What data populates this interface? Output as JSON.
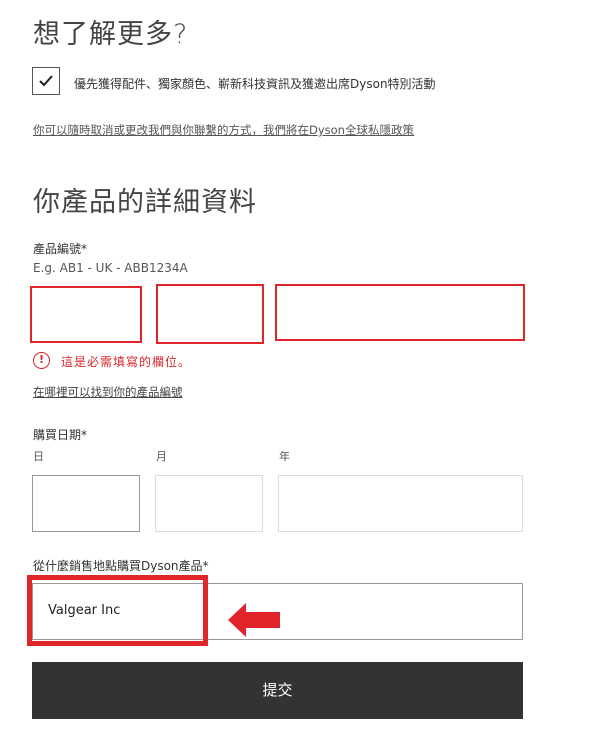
{
  "marketing": {
    "title": "想了解更多?",
    "consent_text": "優先獲得配件、獨家顏色、嶄新科技資訊及獲邀出席Dyson特別活動",
    "consent_checked": true,
    "privacy_text": "你可以隨時取消或更改我們與你聯繫的方式，我們將在Dyson全球私隱政策"
  },
  "product": {
    "title": "你產品的詳細資料",
    "serial_label": "產品編號*",
    "serial_hint": "E.g. AB1 - UK - ABB1234A",
    "error_text": "這是必需填寫的欄位。",
    "find_link": "在哪裡可以找到你的產品編號",
    "date_label": "購買日期*",
    "day_label": "日",
    "month_label": "月",
    "year_label": "年",
    "retailer_label": "從什麼銷售地點購買Dyson產品*",
    "retailer_value": "Valgear Inc",
    "submit_label": "提交"
  },
  "colors": {
    "error": "#d6252b",
    "annotation": "#e0262b",
    "button": "#333333"
  },
  "icons": [
    "checkmark-icon",
    "error-icon",
    "annotation-arrow-icon"
  ]
}
